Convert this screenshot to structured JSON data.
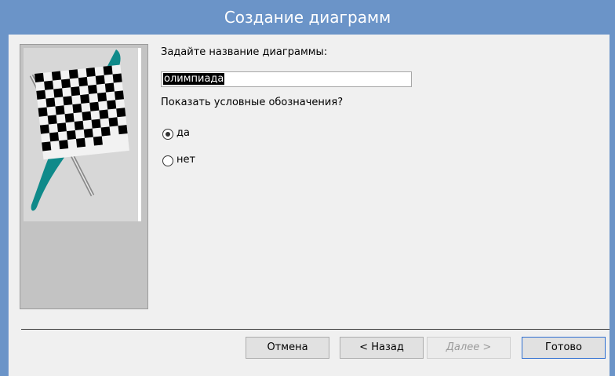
{
  "window": {
    "title": "Создание диаграмм",
    "colors": {
      "titlebar": "#6b94c8",
      "client_bg": "#f0f0f0",
      "accent_teal": "#0f8a8a"
    }
  },
  "form": {
    "name_label": "Задайте название диаграммы:",
    "name_value": "олимпиада",
    "legend_question": "Показать условные обозначения?",
    "options": [
      {
        "label": "да",
        "checked": true
      },
      {
        "label": "нет",
        "checked": false
      }
    ]
  },
  "image": {
    "icon": "checkered-flag-icon"
  },
  "buttons": {
    "cancel": "Отмена",
    "back": "< Назад",
    "next": "Далее >",
    "finish": "Готово"
  }
}
